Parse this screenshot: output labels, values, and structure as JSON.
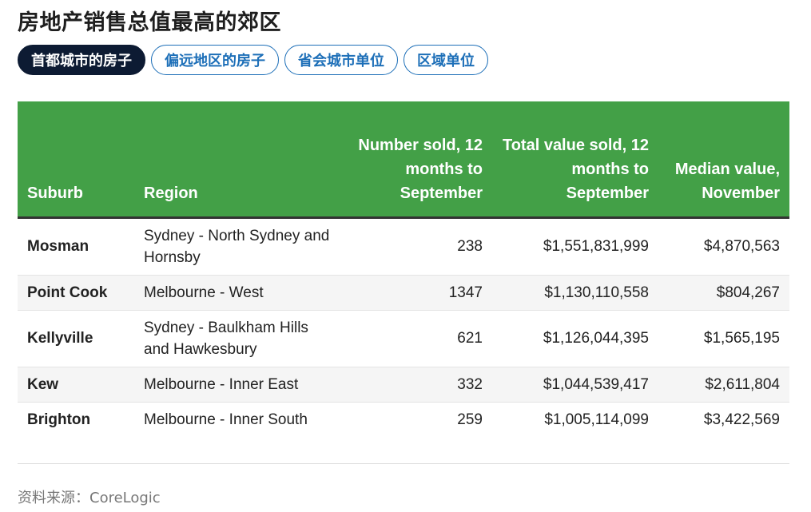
{
  "title": "房地产销售总值最高的郊区",
  "tabs": [
    {
      "label": "首都城市的房子",
      "active": true
    },
    {
      "label": "偏远地区的房子",
      "active": false
    },
    {
      "label": "省会城市单位",
      "active": false
    },
    {
      "label": "区域单位",
      "active": false
    }
  ],
  "table": {
    "headers": [
      "Suburb",
      "Region",
      "Number sold, 12 months to September",
      "Total value sold, 12 months to September",
      "Median value, November"
    ],
    "rows": [
      [
        "Mosman",
        "Sydney - North Sydney and Hornsby",
        "238",
        "$1,551,831,999",
        "$4,870,563"
      ],
      [
        "Point Cook",
        "Melbourne - West",
        "1347",
        "$1,130,110,558",
        "$804,267"
      ],
      [
        "Kellyville",
        "Sydney - Baulkham Hills and Hawkesbury",
        "621",
        "$1,126,044,395",
        "$1,565,195"
      ],
      [
        "Kew",
        "Melbourne - Inner East",
        "332",
        "$1,044,539,417",
        "$2,611,804"
      ],
      [
        "Brighton",
        "Melbourne - Inner South",
        "259",
        "$1,005,114,099",
        "$3,422,569"
      ]
    ]
  },
  "source": "资料来源：CoreLogic",
  "colors": {
    "header_green": "#43a047",
    "tab_blue": "#1d6fb8",
    "tab_active_navy": "#0d1b33"
  }
}
